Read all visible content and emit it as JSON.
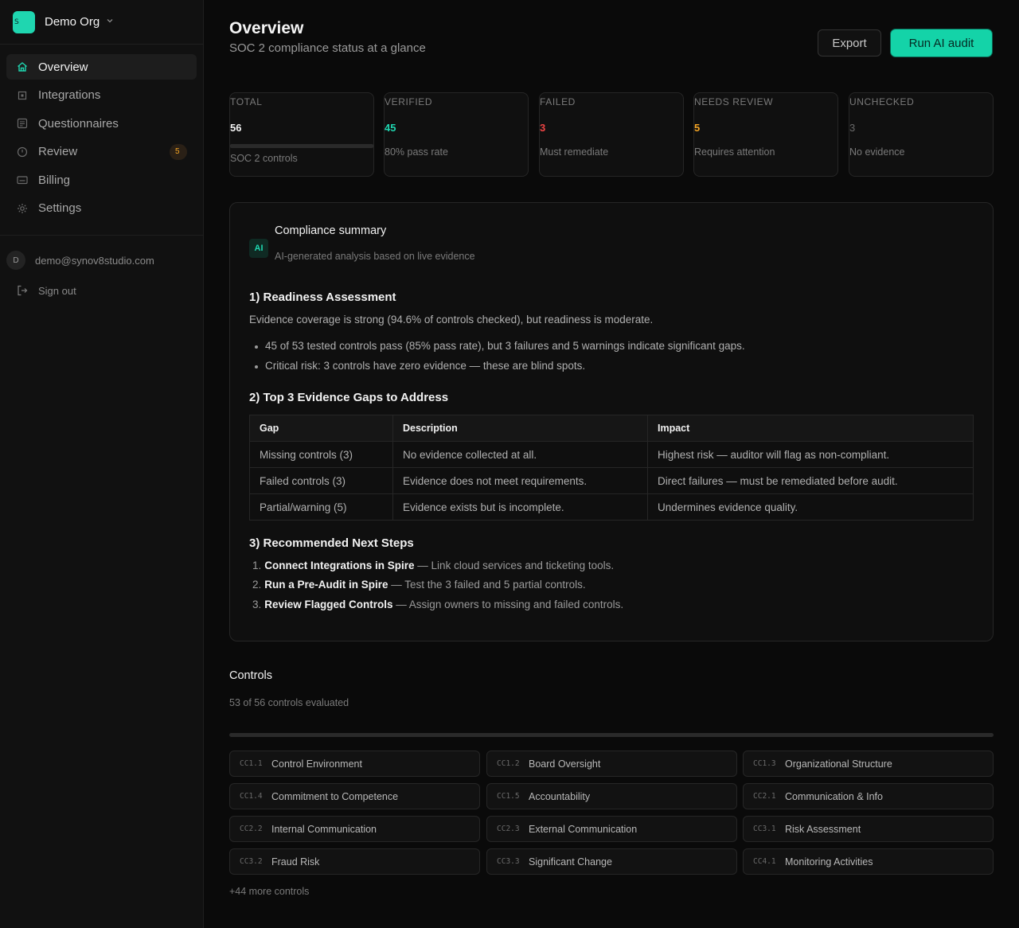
{
  "org": {
    "logo_letter": "S",
    "name": "Demo Org"
  },
  "nav": [
    {
      "label": "Overview",
      "icon": "home-icon",
      "active": true
    },
    {
      "label": "Integrations",
      "icon": "integrations-icon"
    },
    {
      "label": "Questionnaires",
      "icon": "document-icon"
    },
    {
      "label": "Review",
      "icon": "clock-icon",
      "badge": "5"
    },
    {
      "label": "Billing",
      "icon": "card-icon"
    },
    {
      "label": "Settings",
      "icon": "gear-icon"
    }
  ],
  "user": {
    "avatar_letter": "D",
    "email": "demo@synov8studio.com",
    "signout": "Sign out"
  },
  "header": {
    "title": "Overview",
    "subtitle": "SOC 2 compliance status at a glance",
    "export_label": "Export",
    "audit_label": "Run AI audit"
  },
  "stats": [
    {
      "label": "TOTAL",
      "value": "56",
      "sub": "SOC 2 controls",
      "color": "#f2f2f2"
    },
    {
      "label": "VERIFIED",
      "value": "45",
      "sub": "80% pass rate",
      "color": "#1fd6b0"
    },
    {
      "label": "FAILED",
      "value": "3",
      "sub": "Must remediate",
      "color": "#ef4444"
    },
    {
      "label": "NEEDS REVIEW",
      "value": "5",
      "sub": "Requires attention",
      "color": "#f5a524"
    },
    {
      "label": "UNCHECKED",
      "value": "3",
      "sub": "No evidence",
      "color": "#6a6a6a"
    }
  ],
  "summary": {
    "badge": "AI",
    "title": "Compliance summary",
    "subtitle": "AI-generated analysis based on live evidence",
    "section1_title": "1) Readiness Assessment",
    "section1_text": "Evidence coverage is strong (94.6% of controls checked), but readiness is moderate.",
    "bullets": [
      "45 of 53 tested controls pass (85% pass rate), but 3 failures and 5 warnings indicate significant gaps.",
      "Critical risk: 3 controls have zero evidence — these are blind spots."
    ],
    "section2_title": "2) Top 3 Evidence Gaps to Address",
    "table": {
      "headers": [
        "Gap",
        "Description",
        "Impact"
      ],
      "rows": [
        [
          "Missing controls (3)",
          "No evidence collected at all.",
          "Highest risk — auditor will flag as non-compliant."
        ],
        [
          "Failed controls (3)",
          "Evidence does not meet requirements.",
          "Direct failures — must be remediated before audit."
        ],
        [
          "Partial/warning (5)",
          "Evidence exists but is incomplete.",
          "Undermines evidence quality."
        ]
      ]
    },
    "section3_title": "3) Recommended Next Steps",
    "steps": [
      {
        "num": "1.",
        "bold": "Connect Integrations in Spire",
        "rest": " — Link cloud services and ticketing tools."
      },
      {
        "num": "2.",
        "bold": "Run a Pre-Audit in Spire",
        "rest": " — Test the 3 failed and 5 partial controls."
      },
      {
        "num": "3.",
        "bold": "Review Flagged Controls",
        "rest": " — Assign owners to missing and failed controls."
      }
    ]
  },
  "controls": {
    "title": "Controls",
    "subtitle": "53 of 56 controls evaluated",
    "items": [
      {
        "id": "CC1.1",
        "name": "Control Environment"
      },
      {
        "id": "CC1.2",
        "name": "Board Oversight"
      },
      {
        "id": "CC1.3",
        "name": "Organizational Structure"
      },
      {
        "id": "CC1.4",
        "name": "Commitment to Competence"
      },
      {
        "id": "CC1.5",
        "name": "Accountability"
      },
      {
        "id": "CC2.1",
        "name": "Communication & Info"
      },
      {
        "id": "CC2.2",
        "name": "Internal Communication"
      },
      {
        "id": "CC2.3",
        "name": "External Communication"
      },
      {
        "id": "CC3.1",
        "name": "Risk Assessment"
      },
      {
        "id": "CC3.2",
        "name": "Fraud Risk"
      },
      {
        "id": "CC3.3",
        "name": "Significant Change"
      },
      {
        "id": "CC4.1",
        "name": "Monitoring Activities"
      }
    ],
    "more": "+44 more controls"
  }
}
